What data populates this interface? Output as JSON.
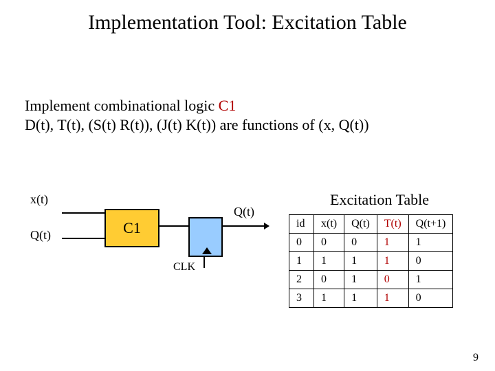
{
  "title": "Implementation Tool: Excitation Table",
  "body": {
    "line1_pre": "Implement combinational logic ",
    "line1_c1": "C1",
    "line2": "D(t), T(t), (S(t) R(t)), (J(t) K(t)) are functions of (x, Q(t))"
  },
  "diagram": {
    "xt": "x(t)",
    "qt_in": "Q(t)",
    "qt_out": "Q(t)",
    "c1": "C1",
    "clk": "CLK"
  },
  "table": {
    "title": "Excitation Table",
    "headers": [
      "id",
      "x(t)",
      "Q(t)",
      "T(t)",
      "Q(t+1)"
    ],
    "rows": [
      [
        "0",
        "0",
        "0",
        "1",
        "1"
      ],
      [
        "1",
        "1",
        "1",
        "1",
        "0"
      ],
      [
        "2",
        "0",
        "1",
        "0",
        "1"
      ],
      [
        "3",
        "1",
        "1",
        "1",
        "0"
      ]
    ]
  },
  "page_number": "9",
  "chart_data": {
    "type": "table",
    "title": "Excitation Table",
    "columns": [
      "id",
      "x(t)",
      "Q(t)",
      "T(t)",
      "Q(t+1)"
    ],
    "rows": [
      {
        "id": 0,
        "x(t)": 0,
        "Q(t)": 0,
        "T(t)": 1,
        "Q(t+1)": 1
      },
      {
        "id": 1,
        "x(t)": 1,
        "Q(t)": 1,
        "T(t)": 1,
        "Q(t+1)": 0
      },
      {
        "id": 2,
        "x(t)": 0,
        "Q(t)": 1,
        "T(t)": 0,
        "Q(t+1)": 1
      },
      {
        "id": 3,
        "x(t)": 1,
        "Q(t)": 1,
        "T(t)": 1,
        "Q(t+1)": 0
      }
    ]
  }
}
